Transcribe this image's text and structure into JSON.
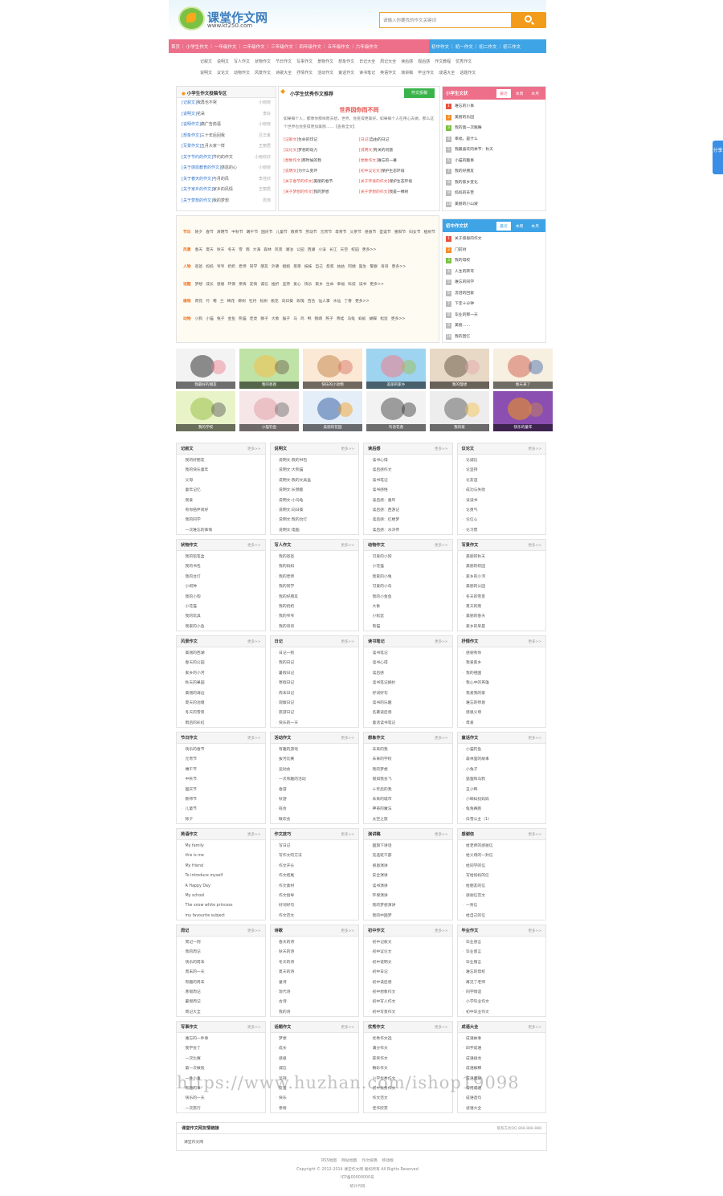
{
  "header": {
    "logo_title": "课堂作文网",
    "logo_url": "www.kt250.com",
    "search_placeholder": "请输入你要找的作文关键词"
  },
  "nav": {
    "pink": [
      "首页",
      "小学生作文",
      "一年级作文",
      "二年级作文",
      "三年级作文",
      "四年级作文",
      "五年级作文",
      "六年级作文"
    ],
    "blue": [
      "初中作文",
      "初一作文",
      "初二作文",
      "初三作文"
    ]
  },
  "subnav": {
    "row1": [
      "记叙文",
      "说明文",
      "写人作文",
      "状物作文",
      "节日作文",
      "写事作文",
      "景物作文",
      "想象作文",
      "日记大全",
      "周记大全",
      "读后感",
      "观后感",
      "作文教程",
      "优秀作文"
    ],
    "row2": [
      "说明文",
      "议论文",
      "动物作文",
      "风景作文",
      "诗歌大全",
      "抒情作文",
      "活动作文",
      "童话作文",
      "读书笔记",
      "英语作文",
      "演讲稿",
      "毕业作文",
      "成语大全",
      "话题作文"
    ]
  },
  "zone": {
    "title": "小学生作文投稿专区",
    "items": [
      {
        "tag": "[记叙文]",
        "text": "我再也不哭",
        "author": "小晓晓"
      },
      {
        "tag": "[说明文]",
        "text": "花朵",
        "author": "李好"
      },
      {
        "tag": "[说明作文]",
        "text": "痛广告箭语",
        "author": "小晓晓"
      },
      {
        "tag": "[想象作文]",
        "text": "三十年后回我",
        "author": "吕华夏"
      },
      {
        "tag": "[写景作文]",
        "text": "五月大家一样",
        "author": "王丽君"
      },
      {
        "tag": "[关于节约的作文]",
        "text": "节约的作文",
        "author": "小雨欢欣"
      },
      {
        "tag": "[关于感恩教育的作文]",
        "text": "感恩的心",
        "author": "小晓晓"
      },
      {
        "tag": "[关于春天的作文]",
        "text": "与月的风",
        "author": "李佳欣"
      },
      {
        "tag": "[关于家乡的作文]",
        "text": "家乡的风情",
        "author": "王丽君"
      },
      {
        "tag": "[关于梦想的作文]",
        "text": "我的梦想",
        "author": "周涛"
      }
    ]
  },
  "recommend": {
    "title": "小学生优秀作文推荐",
    "submit": "作文投稿",
    "headline": "世界因你而不同",
    "desc": "如果每个人，都像你那样而去想，世界，会变得更美好。如果每个人在用心去做，那么这个世界也会变得更加美丽……【查看全文】",
    "items": [
      {
        "tag": "[记叙文]",
        "text": "生命的印记"
      },
      {
        "tag": "[日记]",
        "text": "自由的日记"
      },
      {
        "tag": "[议论文]",
        "text": "梦想的动力"
      },
      {
        "tag": "[说明文]",
        "text": "有关的问题"
      },
      {
        "tag": "[想象作文]",
        "text": "那时候的我"
      },
      {
        "tag": "[想象作文]",
        "text": "难忘的一幕"
      },
      {
        "tag": "[说明文]",
        "text": "为什么变坏"
      },
      {
        "tag": "[初中议论文]",
        "text": "保护生态环境"
      },
      {
        "tag": "[关于春节的作文]",
        "text": "美丽的春节"
      },
      {
        "tag": "[关于环境的作文]",
        "text": "保护生态环境"
      },
      {
        "tag": "[关于梦想的作文]",
        "text": "我的梦想"
      },
      {
        "tag": "[关于梦想的作文]",
        "text": "我是一棵树"
      }
    ]
  },
  "rank_primary": {
    "title": "小学生文状",
    "tabs": [
      "最近",
      "本周",
      "本月"
    ],
    "items": [
      "难忘的小事",
      "美丽的乐园",
      "我的第一次跳舞",
      "幸福，是什么",
      "我最喜欢的季节：秋天",
      "小猫的趣事",
      "我的好朋友",
      "我的家乡变化",
      "妈妈的辛苦",
      "美丽的小山坡"
    ]
  },
  "rank_middle": {
    "title": "初中作文状",
    "tabs": [
      "最近",
      "本周",
      "本月"
    ],
    "items": [
      "关于感恩的作文",
      "门前树",
      "我的母校",
      "人生的转弯",
      "难忘的同学",
      "流泪的回家",
      "下定十分钟",
      "毕业的那一天",
      "美丽……",
      "我的回忆"
    ]
  },
  "topics": [
    {
      "label": "节日",
      "items": [
        "除夕",
        "春节",
        "清明节",
        "中秋节",
        "端午节",
        "国庆节",
        "儿童节",
        "教师节",
        "劳动节",
        "元宵节",
        "母亲节",
        "父亲节",
        "感恩节",
        "圣诞节",
        "重阳节",
        "妇女节",
        "植树节",
        "七夕节",
        "中元节",
        "元旦",
        "新年",
        "情人节"
      ]
    },
    {
      "label": "风景",
      "items": [
        "春天",
        "夏天",
        "秋天",
        "冬天",
        "雪",
        "雨",
        "大海",
        "森林",
        "风景",
        "湖泊",
        "公园",
        "西湖",
        "小溪",
        "长江",
        "天空",
        "校园",
        "更多>>"
      ]
    },
    {
      "label": "人物",
      "items": [
        "爸爸",
        "妈妈",
        "爷爷",
        "奶奶",
        "老师",
        "同学",
        "朋友",
        "外婆",
        "姐姐",
        "弟弟",
        "妹妹",
        "自己",
        "叔叔",
        "姑姑",
        "阿姨",
        "医生",
        "警察",
        "哥哥",
        "更多>>"
      ]
    },
    {
      "label": "话题",
      "items": [
        "梦想",
        "成长",
        "感恩",
        "环保",
        "亲情",
        "友情",
        "诚信",
        "挫折",
        "坚持",
        "爱心",
        "快乐",
        "家乡",
        "生命",
        "幸福",
        "科技",
        "读书",
        "更多>>"
      ]
    },
    {
      "label": "植物",
      "items": [
        "荷花",
        "竹",
        "菊",
        "兰",
        "梅花",
        "柳树",
        "牡丹",
        "松树",
        "桃花",
        "向日葵",
        "玫瑰",
        "百合",
        "仙人掌",
        "水仙",
        "丁香",
        "更多>>"
      ]
    },
    {
      "label": "动物",
      "items": [
        "小狗",
        "小猫",
        "兔子",
        "金鱼",
        "熊猫",
        "老虎",
        "狮子",
        "大象",
        "猴子",
        "马",
        "鸡",
        "鸭",
        "鹦鹉",
        "燕子",
        "青蛙",
        "乌龟",
        "蚂蚁",
        "蝴蝶",
        "松鼠",
        "更多>>"
      ]
    }
  ],
  "gallery": [
    "我最好的朋友",
    "我的爸爸",
    "快乐的小动物",
    "美丽的家乡",
    "我的理想",
    "春天来了",
    "我的学校",
    "小猫钓鱼",
    "美丽的花园",
    "鸟语花香",
    "我的家",
    "快乐的童年"
  ],
  "cards": [
    {
      "title": "记叙文",
      "more": "更多>>",
      "items": [
        "我的好朋友",
        "我的快乐童年",
        "父母",
        "童年记忆",
        "我爱",
        "有你陪伴真好",
        "我的同学",
        "一次难忘的事情"
      ]
    },
    {
      "title": "说明文",
      "more": "更多>>",
      "items": [
        "说明文:我的书包",
        "说明文:大熊猫",
        "说明文:我的文具盒",
        "说明文:长颈鹿",
        "说明文:小乌龟",
        "说明文:向日葵",
        "说明文:我的台灯",
        "说明文:电脑"
      ]
    },
    {
      "title": "读后感",
      "more": "更多>>",
      "items": [
        "读书心得",
        "读后感作文",
        "读书笔记",
        "读书感悟",
        "读后感：童年",
        "读后感：西游记",
        "读后感：红楼梦",
        "读后感：水浒传"
      ]
    },
    {
      "title": "议论文",
      "more": "更多>>",
      "items": [
        "论诚信",
        "论坚持",
        "论友谊",
        "成功与失败",
        "谈读书",
        "论勇气",
        "论信心",
        "论习惯"
      ]
    },
    {
      "title": "状物作文",
      "more": "更多>>",
      "items": [
        "我的铅笔盒",
        "我的书包",
        "我的台灯",
        "小闹钟",
        "我的小狗",
        "小花猫",
        "我的玩具",
        "我家的小鱼"
      ]
    },
    {
      "title": "写人作文",
      "more": "更多>>",
      "items": [
        "我的爸爸",
        "我的妈妈",
        "我的老师",
        "我的同学",
        "我的好朋友",
        "我的奶奶",
        "我的爷爷",
        "我的哥哥"
      ]
    },
    {
      "title": "动物作文",
      "more": "更多>>",
      "items": [
        "可爱的小狗",
        "小花猫",
        "我家的小兔",
        "可爱的小鸟",
        "我的小金鱼",
        "大象",
        "小松鼠",
        "熊猫"
      ]
    },
    {
      "title": "写景作文",
      "more": "更多>>",
      "items": [
        "美丽的秋天",
        "美丽的校园",
        "家乡的小河",
        "美丽的公园",
        "冬天的雪景",
        "夏天的雨",
        "美丽的春天",
        "家乡的早晨"
      ]
    },
    {
      "title": "风景作文",
      "more": "更多>>",
      "items": [
        "美丽的西湖",
        "春天的公园",
        "家乡的小河",
        "秋天的果园",
        "美丽的海边",
        "夏天的池塘",
        "冬天的雪景",
        "雨后的彩虹"
      ]
    },
    {
      "title": "日记",
      "more": "更多>>",
      "items": [
        "日记一则",
        "我的日记",
        "暑假日记",
        "寒假日记",
        "周末日记",
        "观察日记",
        "旅游日记",
        "快乐的一天"
      ]
    },
    {
      "title": "读书笔记",
      "more": "更多>>",
      "items": [
        "读书笔记",
        "读书心得",
        "读后感",
        "读书笔记摘抄",
        "好词好句",
        "读书的乐趣",
        "名著读后感",
        "童话读书笔记"
      ]
    },
    {
      "title": "抒情作文",
      "more": "更多>>",
      "items": [
        "感谢有你",
        "我爱家乡",
        "我的祖国",
        "我心中的英雄",
        "我爱我的家",
        "难忘的师恩",
        "感恩父母",
        "母爱"
      ]
    },
    {
      "title": "节日作文",
      "more": "更多>>",
      "items": [
        "快乐的春节",
        "元宵节",
        "端午节",
        "中秋节",
        "国庆节",
        "教师节",
        "儿童节",
        "除夕"
      ]
    },
    {
      "title": "活动作文",
      "more": "更多>>",
      "items": [
        "有趣的游戏",
        "拔河比赛",
        "运动会",
        "一次有趣的活动",
        "春游",
        "秋游",
        "班会",
        "联欢会"
      ]
    },
    {
      "title": "想象作文",
      "more": "更多>>",
      "items": [
        "未来的我",
        "未来的学校",
        "我的梦想",
        "假如我会飞",
        "十年后的我",
        "未来的城市",
        "神奇的魔法",
        "太空之旅"
      ]
    },
    {
      "title": "童话作文",
      "more": "更多>>",
      "items": [
        "小猫钓鱼",
        "森林里的故事",
        "小兔子",
        "狐狸和乌鸦",
        "丑小鸭",
        "小蝌蚪找妈妈",
        "龟兔赛跑",
        "白雪公主（1）"
      ]
    },
    {
      "title": "英语作文",
      "more": "更多>>",
      "items": [
        "My family",
        "this is me",
        "My friend",
        "To introduce myself",
        "A Happy Day",
        "My school",
        "The snow white princess",
        "my favourite subject"
      ]
    },
    {
      "title": "作文技巧",
      "more": "更多>>",
      "items": [
        "写日记",
        "写作文的方法",
        "作文开头",
        "作文结尾",
        "作文素材",
        "作文指导",
        "好词好句",
        "作文范文"
      ]
    },
    {
      "title": "演讲稿",
      "more": "更多>>",
      "items": [
        "国旗下讲话",
        "竞选班干部",
        "感恩演讲",
        "安全演讲",
        "读书演讲",
        "环保演讲",
        "我的梦想演讲",
        "我的中国梦"
      ]
    },
    {
      "title": "感谢信",
      "more": "更多>>",
      "items": [
        "给老师的感谢信",
        "给父母的一封信",
        "给同学的信",
        "写给妈妈的信",
        "给朋友的信",
        "感谢信范文",
        "一封信",
        "给自己的信"
      ]
    },
    {
      "title": "周记",
      "more": "更多>>",
      "items": [
        "周记一则",
        "我的周记",
        "快乐的周末",
        "周末的一天",
        "有趣的周末",
        "寒假周记",
        "暑假周记",
        "周记大全"
      ]
    },
    {
      "title": "诗歌",
      "more": "更多>>",
      "items": [
        "春天的诗",
        "秋天的诗",
        "冬天的诗",
        "夏天的诗",
        "童诗",
        "现代诗",
        "古诗",
        "我的诗"
      ]
    },
    {
      "title": "初中作文",
      "more": "更多>>",
      "items": [
        "初中记叙文",
        "初中议论文",
        "初中说明文",
        "初中日记",
        "初中读后感",
        "初中想象作文",
        "初中写人作文",
        "初中写景作文"
      ]
    },
    {
      "title": "毕业作文",
      "more": "更多>>",
      "items": [
        "毕业感言",
        "毕业留言",
        "毕业赠言",
        "难忘的母校",
        "再见了老师",
        "同学情谊",
        "小学毕业作文",
        "初中毕业作文"
      ]
    },
    {
      "title": "写事作文",
      "more": "更多>>",
      "items": [
        "难忘的一件事",
        "我学会了",
        "一次比赛",
        "第一次做饭",
        "一件小事",
        "有趣的事",
        "快乐的一天",
        "一次旅行"
      ]
    },
    {
      "title": "话题作文",
      "more": "更多>>",
      "items": [
        "梦想",
        "成长",
        "感恩",
        "诚信",
        "坚持",
        "友谊",
        "快乐",
        "亲情"
      ]
    },
    {
      "title": "优秀作文",
      "more": "更多>>",
      "items": [
        "优秀作文选",
        "满分作文",
        "获奖作文",
        "精彩作文",
        "小学优秀作文",
        "初中优秀作文",
        "作文范文",
        "佳作欣赏"
      ]
    },
    {
      "title": "成语大全",
      "more": "更多>>",
      "items": [
        "成语故事",
        "四字成语",
        "成语接龙",
        "成语解释",
        "成语典故",
        "常用成语",
        "成语造句",
        "谚语大全"
      ]
    }
  ],
  "links": {
    "title": "课堂作文网友情链接",
    "qq": "联系方式QQ 888-888-888",
    "items": [
      "课堂作文网"
    ]
  },
  "footer": {
    "links": [
      "RSS地图",
      "网站地图",
      "作文投稿",
      "移动版"
    ],
    "copyright": "Copyright © 2012-2014 课堂作文网 版权所有 All Rights Reserved",
    "icp": "ICP备00000000号",
    "stats": "统计代码"
  },
  "watermark": "https://www.huzhan.com/ishop19098",
  "share": "分享"
}
